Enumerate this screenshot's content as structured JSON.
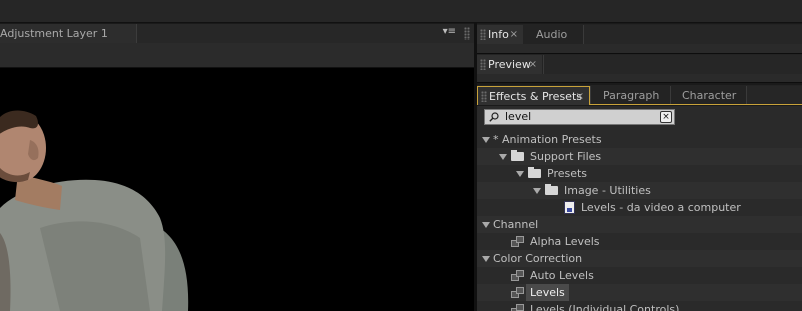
{
  "viewer": {
    "tab_title": "Adjustment Layer 1",
    "menu_glyph": "▾≡"
  },
  "panels": {
    "info_tab": "Info",
    "audio_tab": "Audio",
    "preview_tab": "Preview",
    "effects_tab": "Effects & Presets",
    "paragraph_tab": "Paragraph",
    "character_tab": "Character",
    "close_glyph": "×"
  },
  "search": {
    "value": "level",
    "clear_glyph": "×"
  },
  "tree": {
    "animation_presets": "* Animation Presets",
    "support_files": "Support Files",
    "presets": "Presets",
    "image_utilities": "Image - Utilities",
    "levels_preset": "Levels - da video a computer",
    "channel": "Channel",
    "alpha_levels": "Alpha Levels",
    "color_correction": "Color Correction",
    "auto_levels": "Auto Levels",
    "levels": "Levels",
    "levels_individual": "Levels (Individual Controls)"
  },
  "colors": {
    "accent_underline": "#c8a23a",
    "panel_bg": "#2a2a2a",
    "viewer_bg": "#000000"
  }
}
